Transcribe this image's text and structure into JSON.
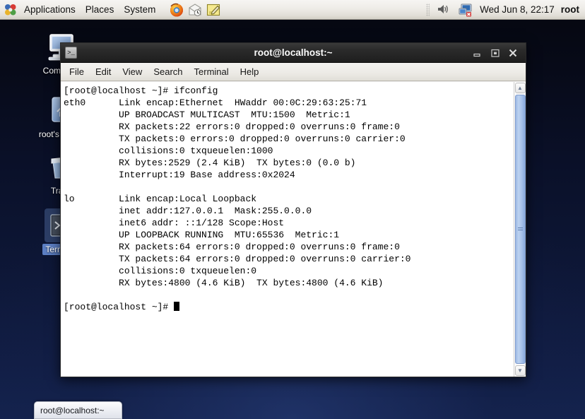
{
  "panel": {
    "logo_icon": "fedora-logo-icon",
    "menus": [
      {
        "label": "Applications",
        "name": "panel-menu-applications"
      },
      {
        "label": "Places",
        "name": "panel-menu-places"
      },
      {
        "label": "System",
        "name": "panel-menu-system"
      }
    ],
    "launchers": [
      {
        "name": "firefox-icon",
        "title": "Firefox Web Browser"
      },
      {
        "name": "evolution-mail-icon",
        "title": "Evolution Mail"
      },
      {
        "name": "text-editor-icon",
        "title": "Text Editor"
      }
    ],
    "tray": [
      {
        "name": "volume-icon"
      },
      {
        "name": "network-disconnected-icon"
      }
    ],
    "clock": "Wed Jun  8, 22:17",
    "user": "root"
  },
  "desktop": {
    "icons": [
      {
        "label": "Computer",
        "name": "desktop-icon-computer",
        "icon": "computer-icon",
        "selected": false
      },
      {
        "label": "root's Home",
        "name": "desktop-icon-root-home",
        "icon": "home-folder-icon",
        "selected": false
      },
      {
        "label": "Trash",
        "name": "desktop-icon-trash",
        "icon": "trash-icon",
        "selected": false
      },
      {
        "label": "Terminal",
        "name": "desktop-icon-terminal",
        "icon": "terminal-icon",
        "selected": true
      }
    ]
  },
  "taskbar": {
    "buttons": [
      {
        "label": "root@localhost:~",
        "name": "taskbar-button-terminal"
      }
    ]
  },
  "window": {
    "title": "root@localhost:~",
    "icon": "terminal-window-icon",
    "controls": {
      "minimize": "minimize-button",
      "maximize": "maximize-button",
      "close": "close-button"
    },
    "menubar": [
      {
        "label": "File",
        "name": "menu-file"
      },
      {
        "label": "Edit",
        "name": "menu-edit"
      },
      {
        "label": "View",
        "name": "menu-view"
      },
      {
        "label": "Search",
        "name": "menu-search"
      },
      {
        "label": "Terminal",
        "name": "menu-terminal"
      },
      {
        "label": "Help",
        "name": "menu-help"
      }
    ],
    "terminal": {
      "lines": [
        "[root@localhost ~]# ifconfig",
        "eth0      Link encap:Ethernet  HWaddr 00:0C:29:63:25:71",
        "          UP BROADCAST MULTICAST  MTU:1500  Metric:1",
        "          RX packets:22 errors:0 dropped:0 overruns:0 frame:0",
        "          TX packets:0 errors:0 dropped:0 overruns:0 carrier:0",
        "          collisions:0 txqueuelen:1000",
        "          RX bytes:2529 (2.4 KiB)  TX bytes:0 (0.0 b)",
        "          Interrupt:19 Base address:0x2024",
        "",
        "lo        Link encap:Local Loopback",
        "          inet addr:127.0.0.1  Mask:255.0.0.0",
        "          inet6 addr: ::1/128 Scope:Host",
        "          UP LOOPBACK RUNNING  MTU:65536  Metric:1",
        "          RX packets:64 errors:0 dropped:0 overruns:0 frame:0",
        "          TX packets:64 errors:0 dropped:0 overruns:0 carrier:0",
        "          collisions:0 txqueuelen:0",
        "          RX bytes:4800 (4.6 KiB)  TX bytes:4800 (4.6 KiB)",
        ""
      ],
      "prompt": "[root@localhost ~]# ",
      "cursor": "block"
    },
    "scrollbar": {
      "up_arrow": "scroll-up-arrow",
      "down_arrow": "scroll-down-arrow"
    }
  },
  "colors": {
    "desktop_top": "#05070f",
    "desktop_bottom": "#14234f",
    "titlebar": "#2b2b2b",
    "panel": "#eeece7",
    "selection": "#5c7fc4",
    "scroll_thumb": "#a8c2e9"
  }
}
